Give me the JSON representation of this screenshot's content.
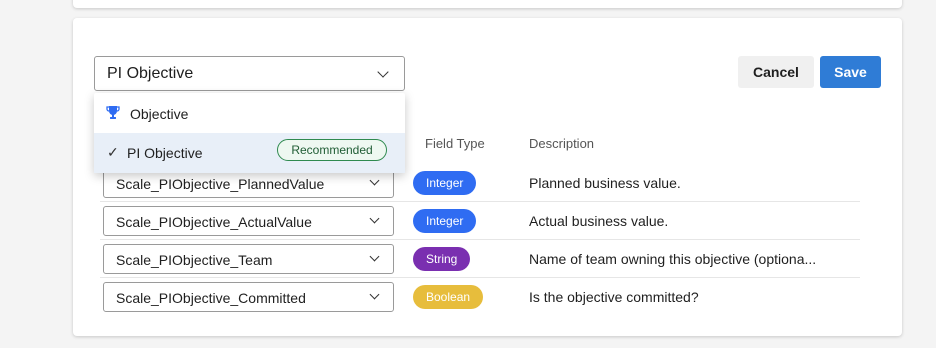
{
  "header": {
    "selected_type": "PI Objective",
    "cancel_label": "Cancel",
    "save_label": "Save"
  },
  "dropdown": {
    "options": [
      {
        "label": "Objective",
        "icon": "trophy-icon",
        "selected": false
      },
      {
        "label": "PI Objective",
        "icon": "checkmark-icon",
        "selected": true,
        "badge": "Recommended"
      }
    ]
  },
  "table": {
    "columns": [
      "Field Type",
      "Description"
    ],
    "rows": [
      {
        "field": "Scale_PIObjective_PlannedValue",
        "type": "Integer",
        "type_color": "#2f6cf2",
        "description": "Planned business value."
      },
      {
        "field": "Scale_PIObjective_ActualValue",
        "type": "Integer",
        "type_color": "#2f6cf2",
        "description": "Actual business value."
      },
      {
        "field": "Scale_PIObjective_Team",
        "type": "String",
        "type_color": "#7a2fb0",
        "description": "Name of team owning this objective (optiona..."
      },
      {
        "field": "Scale_PIObjective_Committed",
        "type": "Boolean",
        "type_color": "#e7bd3c",
        "description": "Is the objective committed?"
      }
    ]
  },
  "colors": {
    "accent": "#2f7cd6",
    "recommended": "#2f8a4f",
    "selected_row_bg": "#e8eff8"
  }
}
